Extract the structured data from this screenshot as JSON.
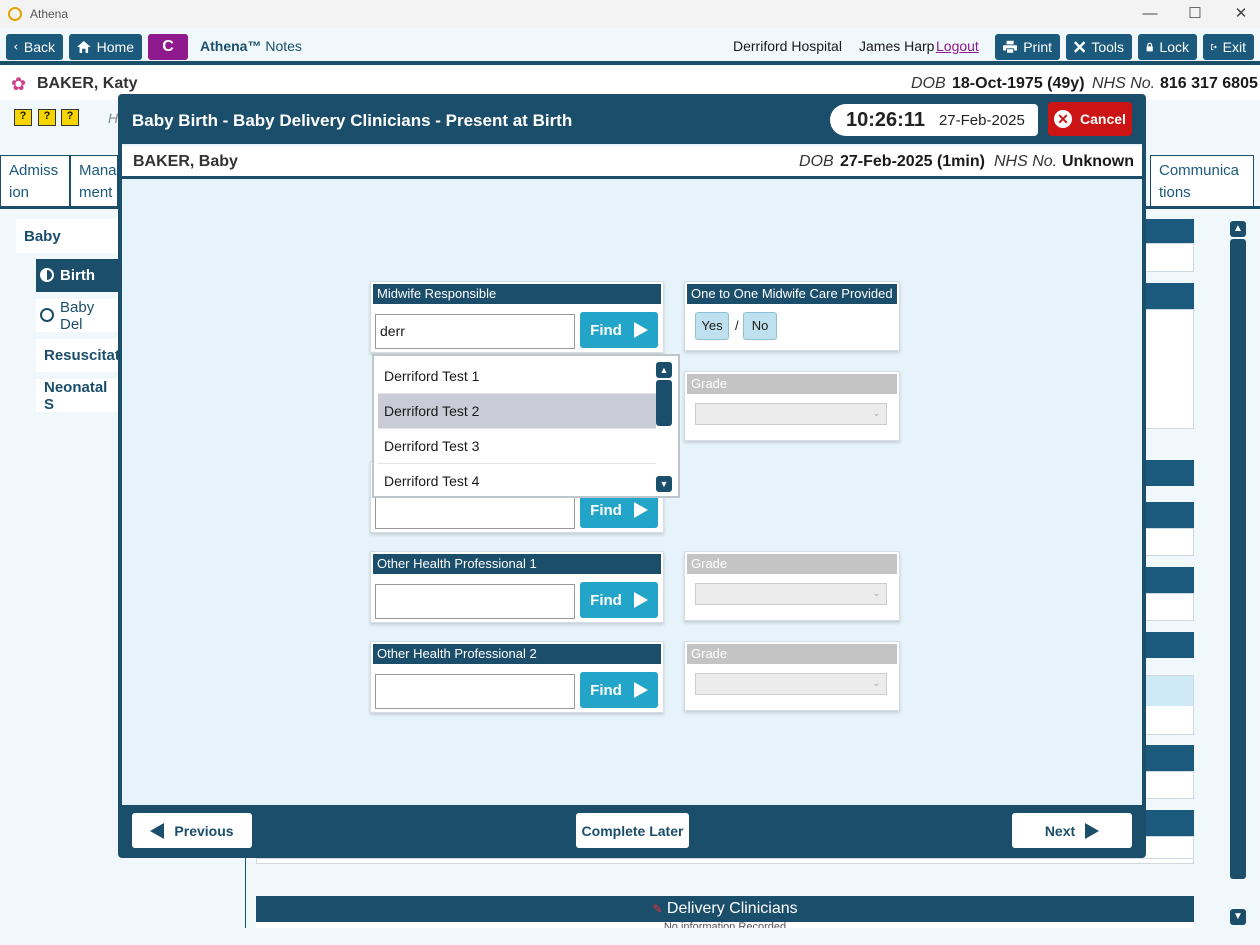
{
  "window": {
    "title": "Athena",
    "minimize": "—",
    "maximize": "☐",
    "close": "✕"
  },
  "toolbar": {
    "back": "Back",
    "home": "Home",
    "c_badge": "C",
    "brand": "Athena™",
    "brand_suffix": "Notes",
    "hospital": "Derriford Hospital",
    "user": "James Harp",
    "logout": "Logout",
    "print": "Print",
    "tools": "Tools",
    "lock": "Lock",
    "exit": "Exit"
  },
  "patient": {
    "name": "BAKER, Katy",
    "dob_label": "DOB",
    "dob": "18-Oct-1975 (49y)",
    "nhs_label": "NHS No.",
    "nhs": "816 317 6805"
  },
  "background": {
    "help_char": "H",
    "tabs": [
      {
        "label": "Admiss ion"
      },
      {
        "label": "Mana ment"
      },
      {
        "label": "Communica tions"
      }
    ],
    "sidebar": {
      "section": "Baby",
      "items": [
        {
          "label": "Birth"
        },
        {
          "label": "Baby Del"
        },
        {
          "label": "Resuscitati"
        },
        {
          "label": "Neonatal S"
        }
      ]
    },
    "bottom_title": "Delivery Clinicians",
    "bottom_sub": "No information Recorded"
  },
  "modal": {
    "title": "Baby Birth - Baby Delivery Clinicians - Present at Birth",
    "time": "10:26:11",
    "date": "27-Feb-2025",
    "cancel": "Cancel",
    "baby": {
      "name": "BAKER, Baby",
      "dob_label": "DOB",
      "dob": "27-Feb-2025 (1min)",
      "nhs_label": "NHS No.",
      "nhs": "Unknown"
    },
    "panels": {
      "midwife": {
        "label": "Midwife Responsible",
        "value": "derr",
        "find": "Find"
      },
      "one_to_one": {
        "label": "One to One Midwife Care Provided",
        "yes": "Yes",
        "sep": "/",
        "no": "No"
      },
      "grade1": {
        "label": "Grade",
        "value": ""
      },
      "row2": {
        "value": "",
        "find": "Find"
      },
      "other1": {
        "label": "Other Health Professional 1",
        "value": "",
        "find": "Find"
      },
      "grade3": {
        "label": "Grade",
        "value": ""
      },
      "other2": {
        "label": "Other Health Professional 2",
        "value": "",
        "find": "Find"
      },
      "grade4": {
        "label": "Grade",
        "value": ""
      }
    },
    "dropdown": {
      "items": [
        {
          "label": "Derriford Test 1"
        },
        {
          "label": "Derriford Test 2"
        },
        {
          "label": "Derriford Test 3"
        },
        {
          "label": "Derriford Test 4"
        }
      ],
      "selected_index": 1
    },
    "footer": {
      "previous": "Previous",
      "complete_later": "Complete Later",
      "next": "Next"
    }
  },
  "colors": {
    "navy": "#1b4e6b",
    "find_blue": "#22a5c8",
    "cancel_red": "#cc1414",
    "c_purple": "#8e1a8e"
  }
}
